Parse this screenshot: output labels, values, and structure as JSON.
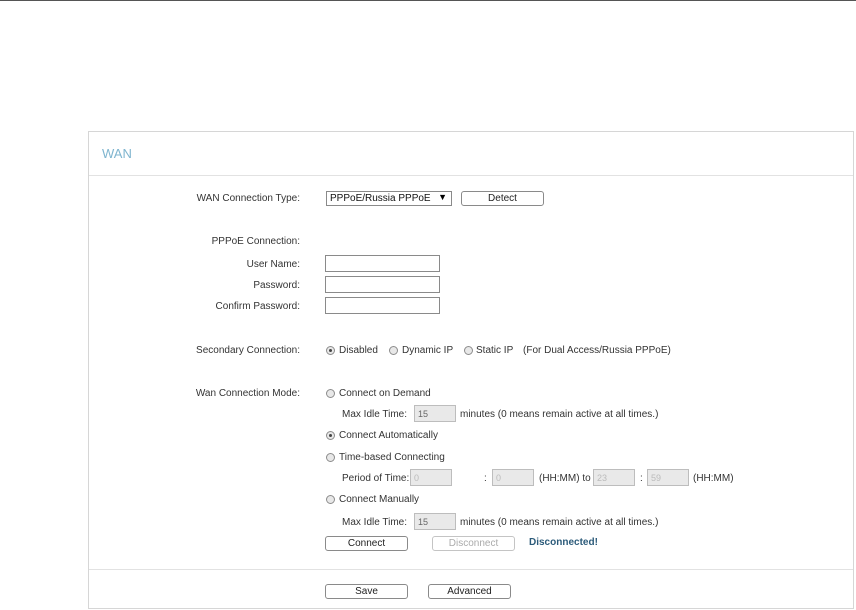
{
  "panel": {
    "title": "WAN"
  },
  "wan_type": {
    "label": "WAN Connection Type:",
    "selected": "PPPoE/Russia PPPoE",
    "detect_label": "Detect"
  },
  "pppoe": {
    "section_label": "PPPoE Connection:",
    "username_label": "User Name:",
    "username_value": "",
    "password_label": "Password:",
    "password_value": "",
    "confirm_label": "Confirm Password:",
    "confirm_value": ""
  },
  "secondary": {
    "label": "Secondary Connection:",
    "options": [
      {
        "label": "Disabled",
        "checked": true
      },
      {
        "label": "Dynamic IP",
        "checked": false
      },
      {
        "label": "Static IP",
        "checked": false
      }
    ],
    "note": "(For Dual Access/Russia PPPoE)"
  },
  "mode": {
    "label": "Wan Connection Mode:",
    "on_demand": {
      "label": "Connect on Demand",
      "checked": false
    },
    "idle1_label": "Max Idle Time:",
    "idle1_value": "15",
    "idle1_suffix": "minutes (0 means remain active at all times.)",
    "auto": {
      "label": "Connect Automatically",
      "checked": true
    },
    "time_based": {
      "label": "Time-based Connecting",
      "checked": false
    },
    "period_label": "Period of Time: from",
    "from_hh": "0",
    "from_mm": "0",
    "hhmm_to": "(HH:MM) to",
    "to_hh": "23",
    "to_mm": "59",
    "hhmm_end": "(HH:MM)",
    "colon": ":",
    "manual": {
      "label": "Connect Manually",
      "checked": false
    },
    "idle2_label": "Max Idle Time:",
    "idle2_value": "15",
    "idle2_suffix": "minutes (0 means remain active at all times.)"
  },
  "actions": {
    "connect_label": "Connect",
    "disconnect_label": "Disconnect",
    "status": "Disconnected!",
    "save_label": "Save",
    "advanced_label": "Advanced"
  },
  "colors": {
    "title": "#7fb5cf",
    "status": "#2c5b7a",
    "border": "#8a8a8a"
  }
}
